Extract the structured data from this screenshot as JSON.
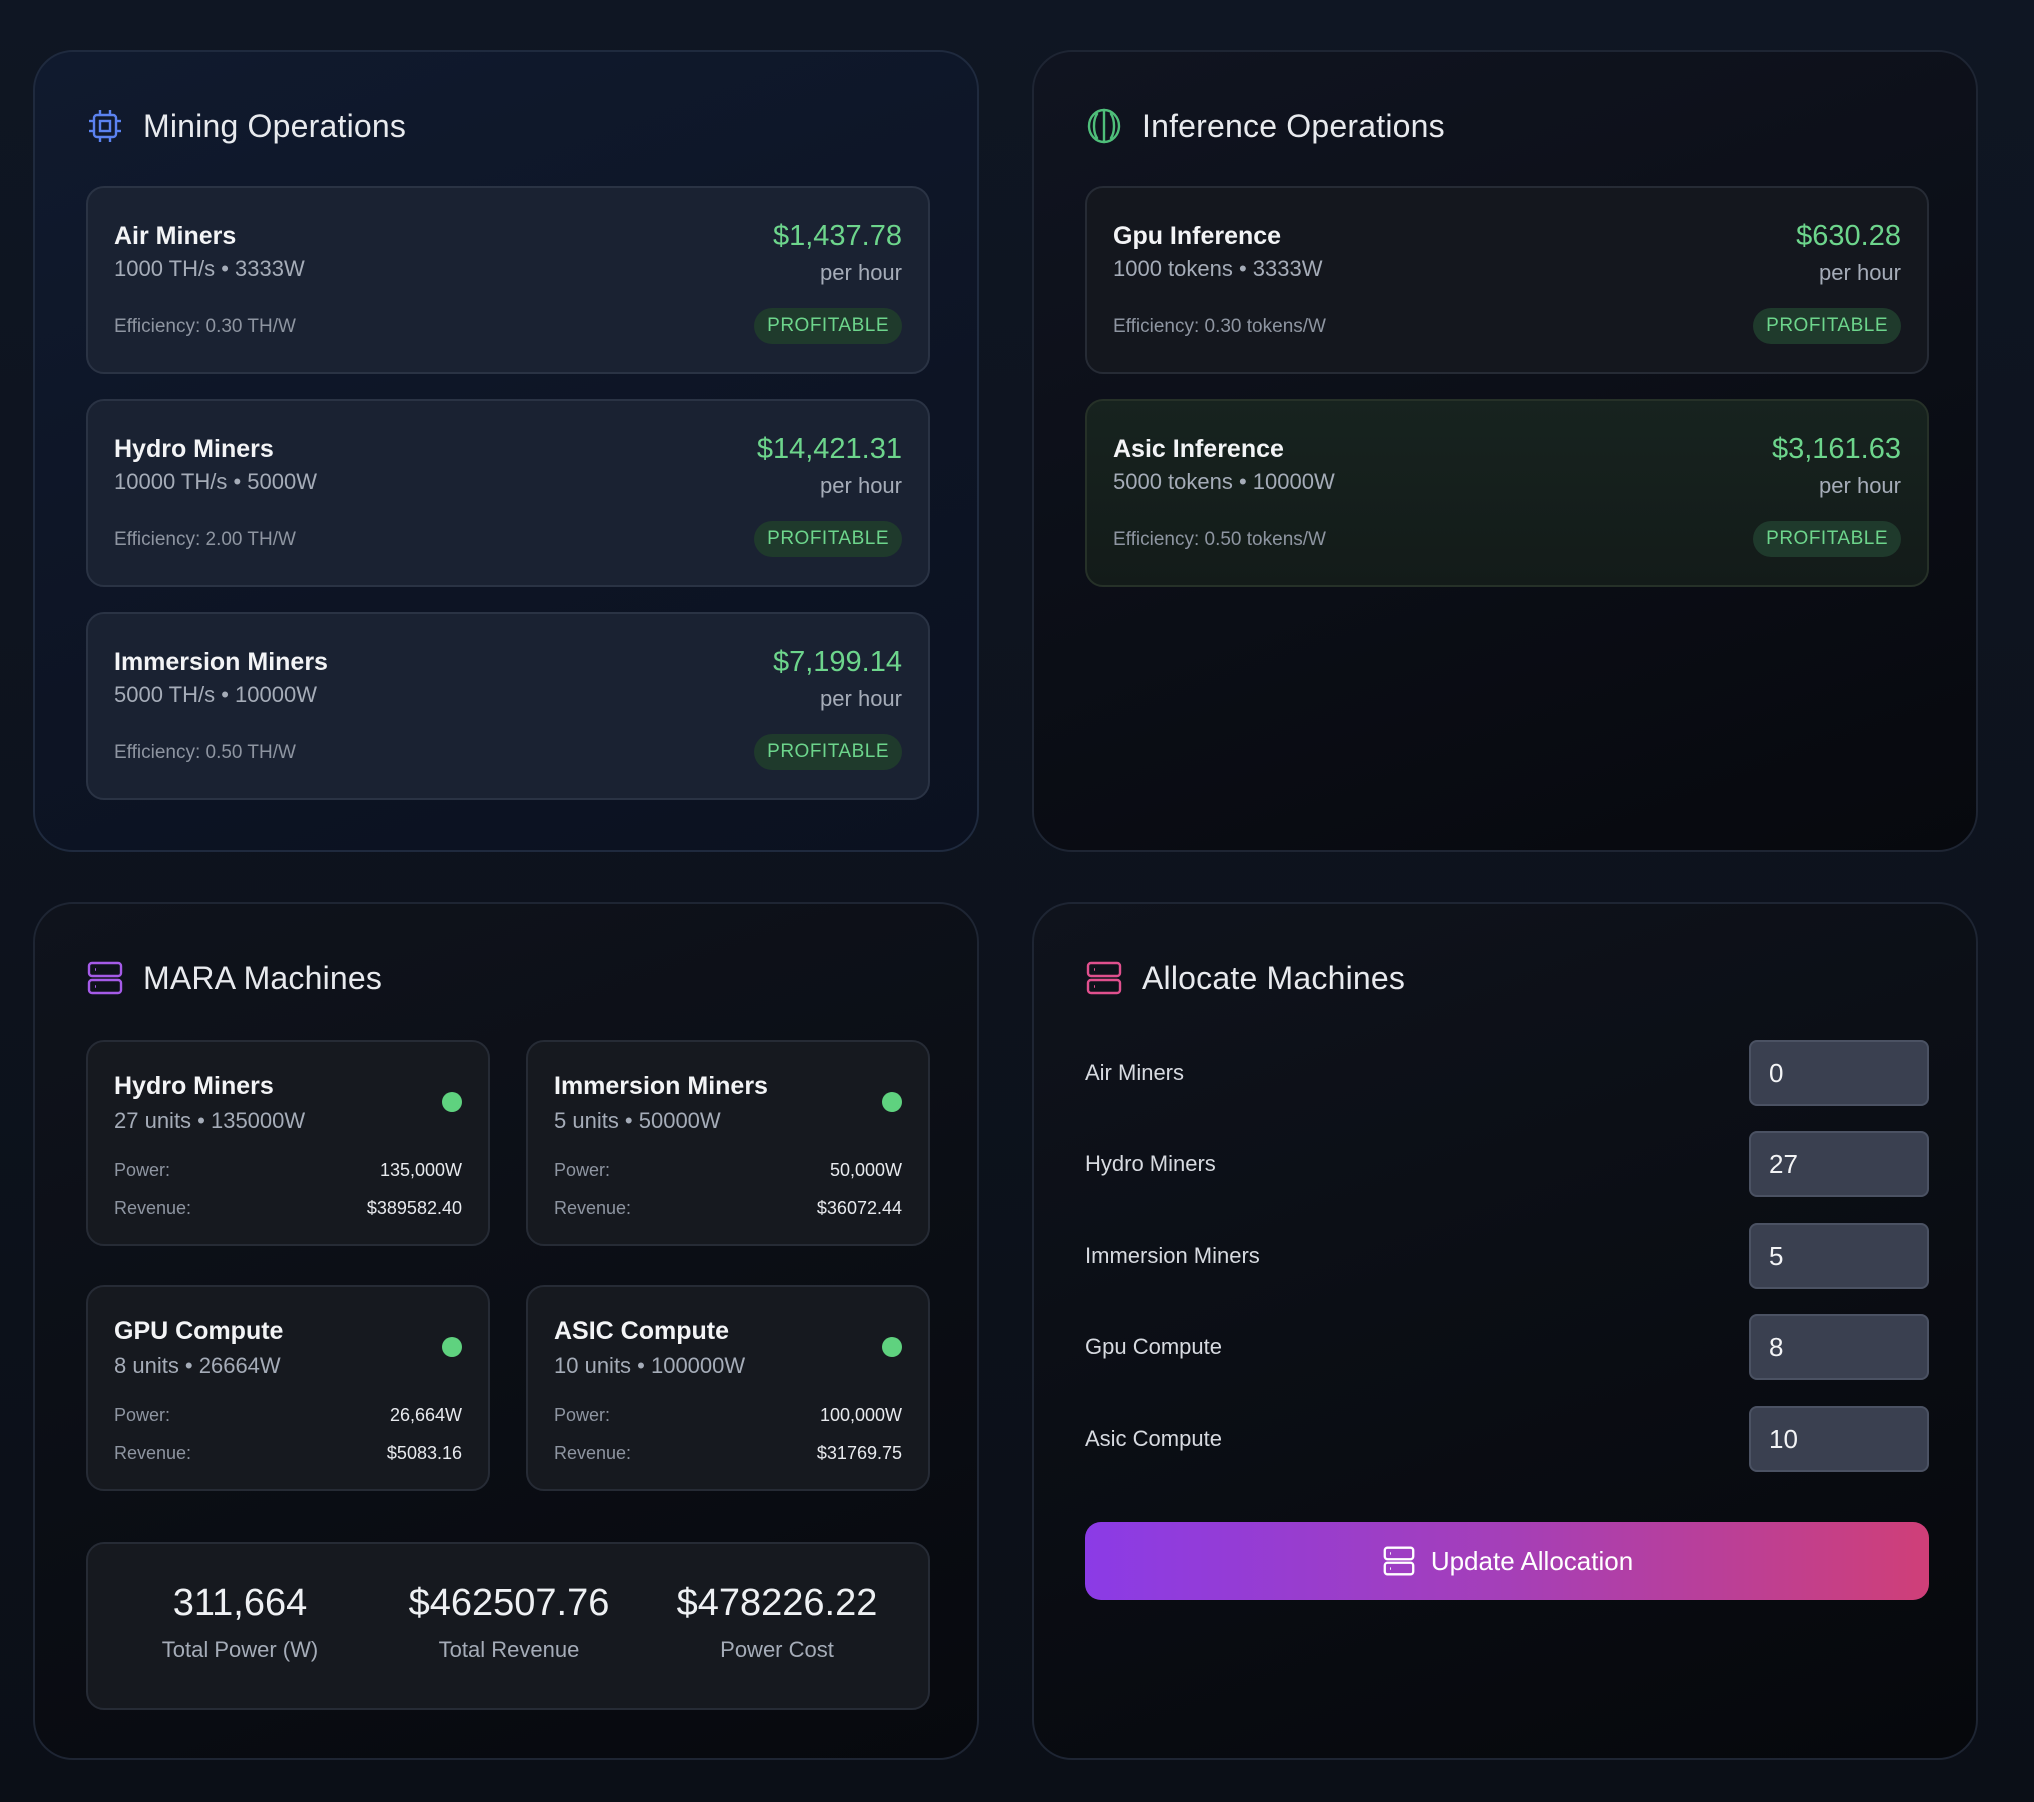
{
  "mining": {
    "title": "Mining Operations",
    "items": [
      {
        "name": "Air Miners",
        "spec": "1000 TH/s • 3333W",
        "efficiency": "Efficiency: 0.30 TH/W",
        "price": "$1,437.78",
        "per": "per hour",
        "status": "PROFITABLE"
      },
      {
        "name": "Hydro Miners",
        "spec": "10000 TH/s • 5000W",
        "efficiency": "Efficiency: 2.00 TH/W",
        "price": "$14,421.31",
        "per": "per hour",
        "status": "PROFITABLE"
      },
      {
        "name": "Immersion Miners",
        "spec": "5000 TH/s • 10000W",
        "efficiency": "Efficiency: 0.50 TH/W",
        "price": "$7,199.14",
        "per": "per hour",
        "status": "PROFITABLE"
      }
    ]
  },
  "inference": {
    "title": "Inference Operations",
    "items": [
      {
        "name": "Gpu Inference",
        "spec": "1000 tokens • 3333W",
        "efficiency": "Efficiency: 0.30 tokens/W",
        "price": "$630.28",
        "per": "per hour",
        "status": "PROFITABLE"
      },
      {
        "name": "Asic Inference",
        "spec": "5000 tokens • 10000W",
        "efficiency": "Efficiency: 0.50 tokens/W",
        "price": "$3,161.63",
        "per": "per hour",
        "status": "PROFITABLE"
      }
    ]
  },
  "mara": {
    "title": "MARA Machines",
    "power_label": "Power:",
    "revenue_label": "Revenue:",
    "machines": [
      {
        "name": "Hydro Miners",
        "spec": "27 units • 135000W",
        "power": "135,000W",
        "revenue": "$389582.40"
      },
      {
        "name": "Immersion Miners",
        "spec": "5 units • 50000W",
        "power": "50,000W",
        "revenue": "$36072.44"
      },
      {
        "name": "GPU Compute",
        "spec": "8 units • 26664W",
        "power": "26,664W",
        "revenue": "$5083.16"
      },
      {
        "name": "ASIC Compute",
        "spec": "10 units • 100000W",
        "power": "100,000W",
        "revenue": "$31769.75"
      }
    ],
    "totals": [
      {
        "value": "311,664",
        "label": "Total Power (W)"
      },
      {
        "value": "$462507.76",
        "label": "Total Revenue"
      },
      {
        "value": "$478226.22",
        "label": "Power Cost"
      }
    ]
  },
  "allocate": {
    "title": "Allocate Machines",
    "rows": [
      {
        "label": "Air Miners",
        "value": "0"
      },
      {
        "label": "Hydro Miners",
        "value": "27"
      },
      {
        "label": "Immersion Miners",
        "value": "5"
      },
      {
        "label": "Gpu Compute",
        "value": "8"
      },
      {
        "label": "Asic Compute",
        "value": "10"
      }
    ],
    "button": "Update Allocation"
  },
  "colors": {
    "profit_green": "#6dd58c",
    "status_dot": "#5fd27f",
    "mining_icon": "#5b82f0",
    "inference_icon": "#4fbf7a",
    "mara_icon": "#a55be8",
    "allocate_icon": "#e0508e"
  }
}
